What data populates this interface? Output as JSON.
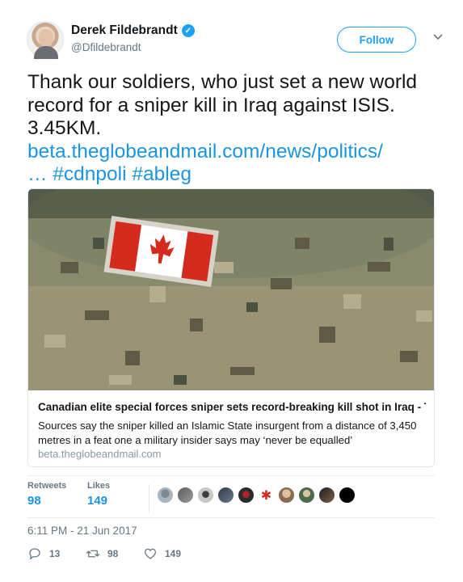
{
  "author": {
    "display_name": "Derek Fildebrandt",
    "handle": "@Dfildebrandt",
    "verified_icon": "verified-badge-icon"
  },
  "follow_button": {
    "label": "Follow"
  },
  "menu_caret": {
    "icon": "chevron-down-icon",
    "glyph": "⌄"
  },
  "tweet": {
    "text_lines": [
      "Thank our soldiers, who just set a new world",
      "record for a sniper kill in Iraq against ISIS.",
      "3.45KM."
    ],
    "link_line1": "beta.theglobeandmail.com/news/politics/",
    "link_line2": "… #cdnpoli #ableg"
  },
  "card": {
    "title": "Canadian elite special forces sniper sets record-breaking kill shot in Iraq - Th…",
    "description": "Sources say the sniper killed an Islamic State insurgent from a distance of 3,450 metres in a feat one a military insider says may ‘never be equalled’",
    "domain": "beta.theglobeandmail.com"
  },
  "stats": {
    "retweets_label": "Retweets",
    "retweets_count": "98",
    "likes_label": "Likes",
    "likes_count": "149"
  },
  "timestamp": "6:11 PM - 21 Jun 2017",
  "actions": {
    "reply_count": "13",
    "retweet_count": "98",
    "like_count": "149"
  },
  "colors": {
    "accent": "#1da1f2",
    "link": "#1b95e0",
    "muted": "#657786"
  }
}
